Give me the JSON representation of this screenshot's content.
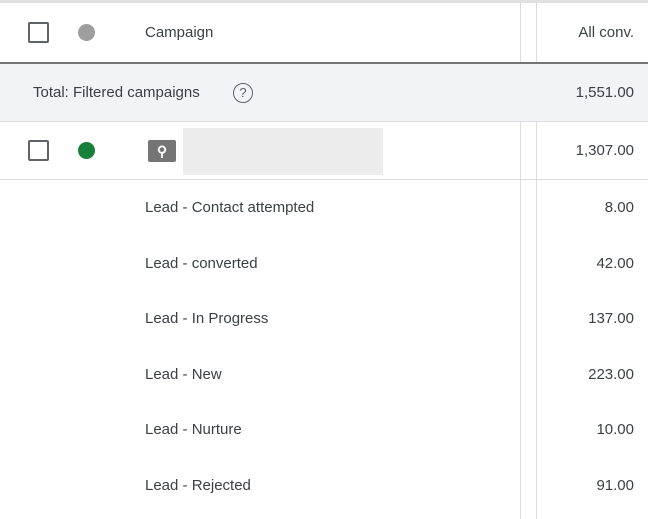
{
  "header": {
    "campaign_label": "Campaign",
    "conv_label": "All conv.",
    "status_color": "#9e9e9e"
  },
  "total": {
    "label": "Total: Filtered campaigns",
    "help_icon": "help-circle-icon",
    "value": "1,551.00"
  },
  "campaign": {
    "status_color": "#188038",
    "type_icon": "search-icon",
    "value": "1,307.00"
  },
  "rows": [
    {
      "label": "Lead - Contact attempted",
      "value": "8.00"
    },
    {
      "label": "Lead - converted",
      "value": "42.00"
    },
    {
      "label": "Lead - In Progress",
      "value": "137.00"
    },
    {
      "label": "Lead - New",
      "value": "223.00"
    },
    {
      "label": "Lead - Nurture",
      "value": "10.00"
    },
    {
      "label": "Lead - Rejected",
      "value": "91.00"
    }
  ]
}
